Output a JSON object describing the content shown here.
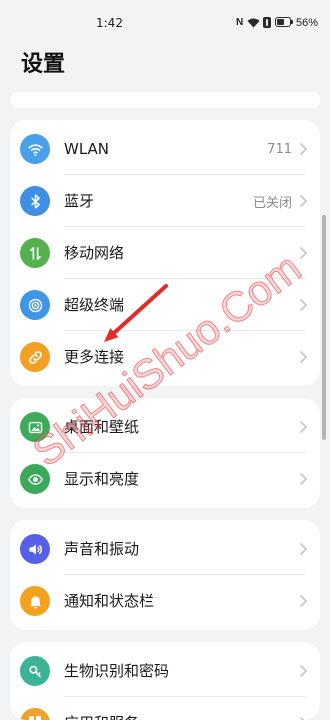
{
  "status_bar": {
    "time": "1:42",
    "nfc_label": "N",
    "battery_text": "56%",
    "battery_level": 0.56
  },
  "header": {
    "title": "设置"
  },
  "groups": {
    "connectivity": [
      {
        "label": "WLAN",
        "value": "711",
        "icon": "wifi-icon",
        "color": "#4aa0e8"
      },
      {
        "label": "蓝牙",
        "value": "已关闭",
        "icon": "bluetooth-icon",
        "color": "#3f8fe4"
      },
      {
        "label": "移动网络",
        "icon": "mobile-network-icon",
        "color": "#55b14f"
      },
      {
        "label": "超级终端",
        "icon": "super-device-icon",
        "color": "#3f95e6"
      },
      {
        "label": "更多连接",
        "icon": "link-icon",
        "color": "#f3a024"
      }
    ],
    "display": [
      {
        "label": "桌面和壁纸",
        "icon": "wallpaper-icon",
        "color": "#3fab59"
      },
      {
        "label": "显示和亮度",
        "icon": "display-brightness-icon",
        "color": "#3aa95a"
      }
    ],
    "sound_notify": [
      {
        "label": "声音和振动",
        "icon": "speaker-icon",
        "color": "#5560e6"
      },
      {
        "label": "通知和状态栏",
        "icon": "bell-icon",
        "color": "#f4a21e"
      }
    ],
    "security_apps": [
      {
        "label": "生物识别和密码",
        "icon": "key-icon",
        "color": "#3ab396"
      },
      {
        "label": "应用和服务",
        "icon": "apps-icon",
        "color": "#f0a22a"
      }
    ]
  },
  "overlay": {
    "watermark_text": "ShiHuiShuo.Com",
    "arrow_color": "#e22b2b"
  },
  "colors": {
    "background": "#f1f3f5",
    "card": "#ffffff"
  }
}
